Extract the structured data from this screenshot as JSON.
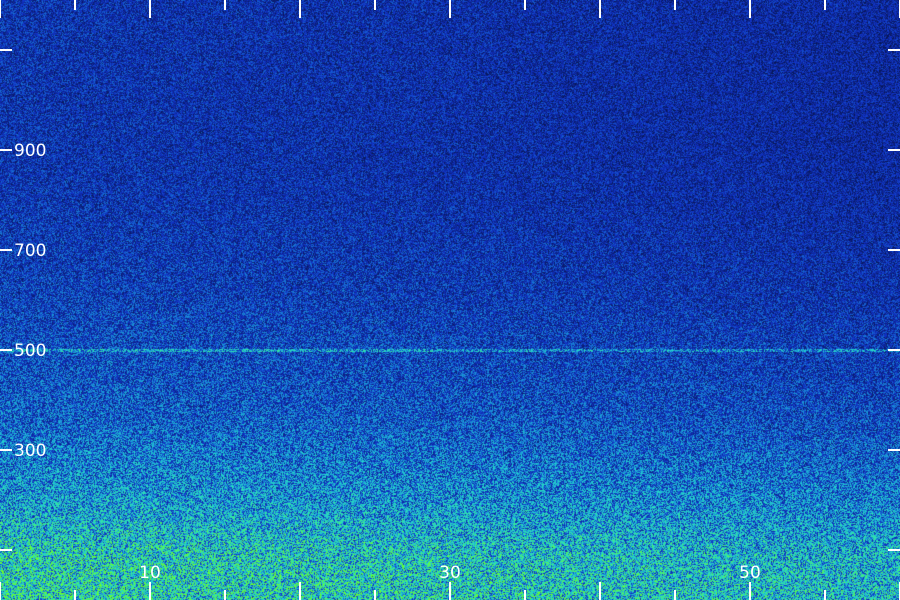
{
  "chart_data": {
    "type": "heatmap",
    "title": "",
    "xlabel": "",
    "ylabel": "",
    "xlim": [
      0,
      60
    ],
    "ylim": [
      0,
      1200
    ],
    "x_ticks": [
      0,
      5,
      10,
      15,
      20,
      25,
      30,
      35,
      40,
      45,
      50,
      55,
      60
    ],
    "x_tick_labels": [
      {
        "value": 10,
        "label": "10"
      },
      {
        "value": 30,
        "label": "30"
      },
      {
        "value": 50,
        "label": "50"
      }
    ],
    "y_ticks": [
      100,
      300,
      500,
      700,
      900,
      1100
    ],
    "y_tick_labels": [
      {
        "value": 300,
        "label": "300"
      },
      {
        "value": 500,
        "label": "500"
      },
      {
        "value": 700,
        "label": "700"
      },
      {
        "value": 900,
        "label": "900"
      }
    ],
    "grid": false,
    "colormap": [
      "#000000",
      "#0b1f7a",
      "#1133c8",
      "#1a8fd6",
      "#22d3d0",
      "#38e89a",
      "#6aff2a"
    ],
    "intensity_profile": {
      "y": [
        0,
        50,
        100,
        150,
        200,
        250,
        300,
        350,
        400,
        450,
        500,
        600,
        700,
        800,
        900,
        1000,
        1100,
        1200
      ],
      "level": [
        0.88,
        0.86,
        0.82,
        0.74,
        0.66,
        0.6,
        0.55,
        0.5,
        0.47,
        0.45,
        0.44,
        0.4,
        0.38,
        0.36,
        0.35,
        0.35,
        0.35,
        0.35
      ]
    },
    "x_falloff": {
      "x": [
        0,
        30,
        60
      ],
      "factor": [
        1.0,
        0.93,
        0.85
      ]
    },
    "horizontal_lines": [
      {
        "y": 500,
        "level": 0.68
      }
    ]
  }
}
